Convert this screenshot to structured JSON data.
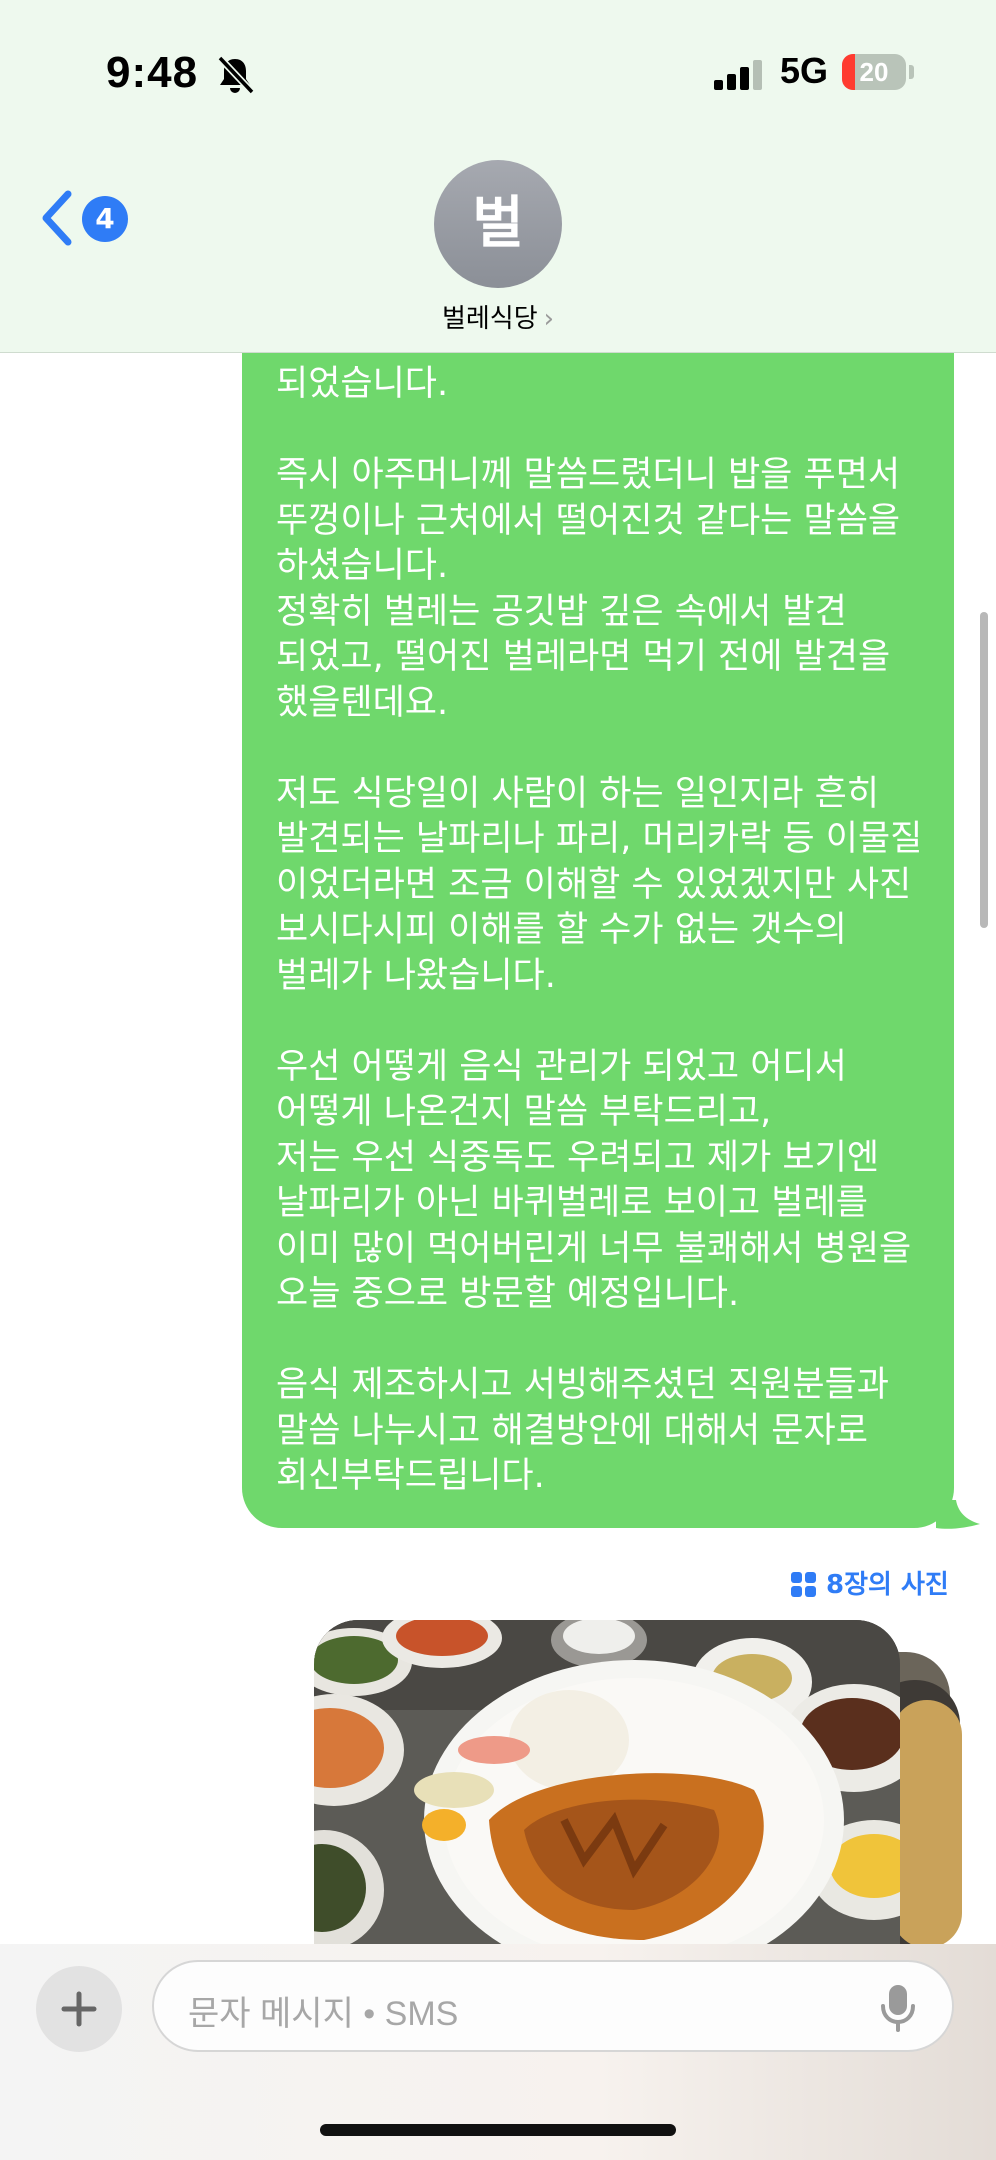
{
  "status_bar": {
    "time": "9:48",
    "network": "5G",
    "battery": "20",
    "battery_level": 0.2
  },
  "header": {
    "back_badge": "4",
    "avatar_initial": "벌",
    "contact_name": "벌레식당",
    "contact_chevron": "›"
  },
  "message": {
    "paragraphs": [
      [
        "되었습니다."
      ],
      [
        "즉시 아주머니께 말씀드렸더니 밥을 푸면서",
        "뚜껑이나 근처에서 떨어진것 같다는 말씀을",
        "하셨습니다.",
        "정확히 벌레는 공깃밥 깊은 속에서 발견",
        "되었고, 떨어진 벌레라면 먹기 전에 발견을",
        "했을텐데요."
      ],
      [
        "저도 식당일이 사람이 하는 일인지라 흔히",
        "발견되는 날파리나 파리, 머리카락 등 이물질",
        "이었더라면 조금 이해할 수 있었겠지만 사진",
        "보시다시피 이해를 할 수가 없는 갯수의",
        "벌레가 나왔습니다."
      ],
      [
        "우선 어떻게 음식 관리가 되었고 어디서",
        "어떻게 나온건지 말씀 부탁드리고,",
        "저는 우선 식중독도 우려되고 제가 보기엔",
        "날파리가 아닌 바퀴벌레로 보이고 벌레를",
        "이미 많이 먹어버린게 너무 불쾌해서 병원을",
        "오늘 중으로 방문할 예정입니다."
      ],
      [
        "음식 제조하시고 서빙해주셨던 직원분들과",
        "말씀 나누시고 해결방안에 대해서 문자로",
        "회신부탁드립니다."
      ]
    ]
  },
  "photos": {
    "count_number": "8",
    "count_suffix": "장의 사진"
  },
  "compose": {
    "placeholder": "문자 메시지 • SMS"
  },
  "colors": {
    "bubble": "#6fd86c",
    "accent": "#2f7cf6",
    "header_bg": "#eef9ee"
  },
  "icons": [
    "bell-slash-icon",
    "signal-icon",
    "battery-icon",
    "back-chevron-icon",
    "photo-grid-icon",
    "plus-icon",
    "microphone-icon"
  ]
}
